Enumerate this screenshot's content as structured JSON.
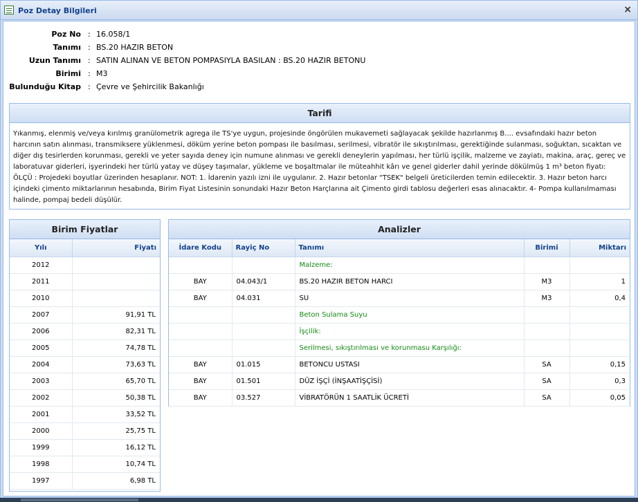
{
  "window": {
    "title": "Poz Detay Bilgileri",
    "close_glyph": "×"
  },
  "info": [
    {
      "label": "Poz No",
      "value": "16.058/1"
    },
    {
      "label": "Tanımı",
      "value": "BS.20 HAZIR BETON"
    },
    {
      "label": "Uzun Tanımı",
      "value": "SATIN ALINAN VE BETON POMPASIYLA BASILAN : BS.20 HAZIR BETONU"
    },
    {
      "label": "Birimi",
      "value": "M3"
    },
    {
      "label": "Bulunduğu Kitap",
      "value": "Çevre ve Şehircilik Bakanlığı"
    }
  ],
  "info_separator": ":",
  "tarifi": {
    "title": "Tarifi",
    "text": "Yıkanmış, elenmiş ve/veya kırılmış granülometrik agrega ile TS'ye uygun, projesinde öngörülen mukavemeti sağlayacak şekilde hazırlanmış B.... evsafındaki hazır beton harcının satın alınması, transmiksere yüklenmesi, döküm yerine beton pompası ile basılması, serilmesi, vibratör ile sıkıştırılması, gerektiğinde sulanması, soğuktan, sıcaktan ve diğer dış tesirlerden korunması, gerekli ve yeter sayıda deney için numune alınması ve gerekli deneylerin yapılması, her türlü işçilik, malzeme ve zayiatı, makina, araç, gereç ve laboratuvar giderleri, işyerindeki her türlü yatay ve düşey taşımalar, yükleme ve boşaltmalar ile müteahhit kârı ve genel giderler dahil yerinde dökülmüş 1 m³ beton fiyatı: ÖLÇÜ : Projedeki boyutlar üzerinden hesaplanır. NOT: 1. İdarenin yazılı izni ile uygulanır. 2. Hazır betonlar \"TSEK\" belgeli üreticilerden temin edilecektir. 3. Hazır beton harcı içindeki çimento miktarlarının hesabında, Birim Fiyat Listesinin sonundaki Hazır Beton Harçlarına ait Çimento girdi tablosu değerleri esas alınacaktır. 4- Pompa kullanılmaması halinde, pompaj bedeli düşülür."
  },
  "birim_fiyatlar": {
    "title": "Birim Fiyatlar",
    "headers": [
      "Yılı",
      "Fiyatı"
    ],
    "rows": [
      {
        "year": "2012",
        "price": ""
      },
      {
        "year": "2011",
        "price": ""
      },
      {
        "year": "2010",
        "price": ""
      },
      {
        "year": "2007",
        "price": "91,91 TL"
      },
      {
        "year": "2006",
        "price": "82,31 TL"
      },
      {
        "year": "2005",
        "price": "74,78 TL"
      },
      {
        "year": "2004",
        "price": "73,63 TL"
      },
      {
        "year": "2003",
        "price": "65,70 TL"
      },
      {
        "year": "2002",
        "price": "50,38 TL"
      },
      {
        "year": "2001",
        "price": "33,52 TL"
      },
      {
        "year": "2000",
        "price": "25,75 TL"
      },
      {
        "year": "1999",
        "price": "16,12 TL"
      },
      {
        "year": "1998",
        "price": "10,74 TL"
      },
      {
        "year": "1997",
        "price": "6,98 TL"
      }
    ]
  },
  "analizler": {
    "title": "Analizler",
    "headers": [
      "İdare Kodu",
      "Rayiç No",
      "Tanımı",
      "Birimi",
      "Miktarı"
    ],
    "rows": [
      {
        "idare": "",
        "rayic": "",
        "tanim": "Malzeme:",
        "birim": "",
        "miktar": "",
        "group": true
      },
      {
        "idare": "BAY",
        "rayic": "04.043/1",
        "tanim": "BS.20 HAZIR BETON HARCI",
        "birim": "M3",
        "miktar": "1",
        "group": false
      },
      {
        "idare": "BAY",
        "rayic": "04.031",
        "tanim": "SU",
        "birim": "M3",
        "miktar": "0,4",
        "group": false
      },
      {
        "idare": "",
        "rayic": "",
        "tanim": "Beton Sulama Suyu",
        "birim": "",
        "miktar": "",
        "group": true
      },
      {
        "idare": "",
        "rayic": "",
        "tanim": "İşçilik:",
        "birim": "",
        "miktar": "",
        "group": true
      },
      {
        "idare": "",
        "rayic": "",
        "tanim": "Serilmesi, sıkıştırılması ve korunmasu Karşılığı:",
        "birim": "",
        "miktar": "",
        "group": true
      },
      {
        "idare": "BAY",
        "rayic": "01.015",
        "tanim": "BETONCU USTASI",
        "birim": "SA",
        "miktar": "0,15",
        "group": false
      },
      {
        "idare": "BAY",
        "rayic": "01.501",
        "tanim": "DÜZ İŞÇİ (İNŞAATİŞÇİSİ)",
        "birim": "SA",
        "miktar": "0,3",
        "group": false
      },
      {
        "idare": "BAY",
        "rayic": "03.527",
        "tanim": "VİBRATÖRÜN 1 SAATLİK ÜCRETİ",
        "birim": "SA",
        "miktar": "0,05",
        "group": false
      }
    ]
  },
  "icons": {
    "title": "form-icon",
    "close": "close-icon"
  },
  "colors": {
    "group_text": "#138a13",
    "header_text": "#15428b",
    "border": "#99bbe8"
  }
}
